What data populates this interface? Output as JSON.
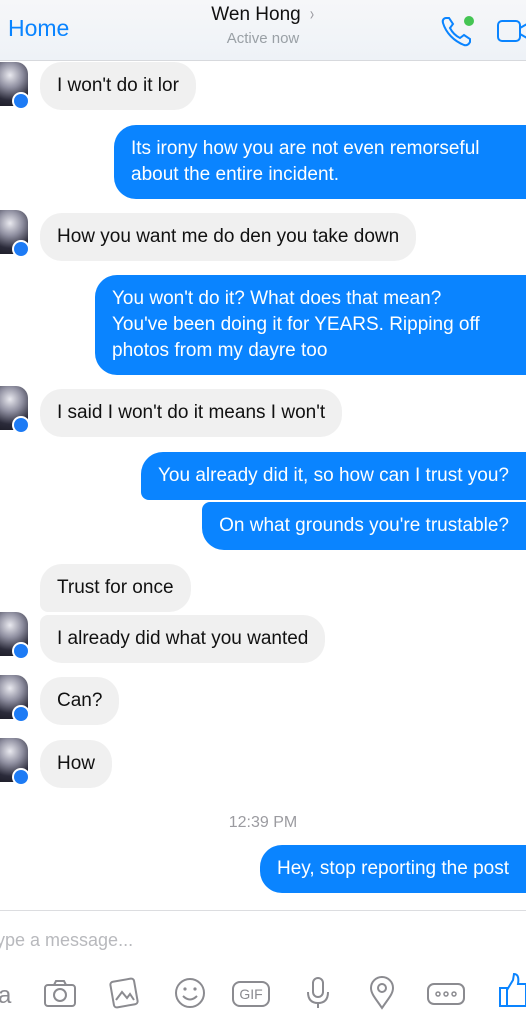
{
  "header": {
    "back_label": "Home",
    "contact_name": "Wen Hong",
    "chevron": "›",
    "status": "Active now",
    "icons": [
      "phone-icon",
      "video-icon",
      "online-dot-icon"
    ]
  },
  "messages": [
    {
      "from": "them",
      "text": "I won't do it lor"
    },
    {
      "from": "me",
      "lines": [
        "Its irony how you are not even remorseful",
        "about the entire incident."
      ]
    },
    {
      "from": "them",
      "text": "How you want me do den you take down"
    },
    {
      "from": "me",
      "lines": [
        "You won't do it? What does that mean?",
        "You've been doing it for YEARS. Ripping off",
        "photos from my dayre too"
      ]
    },
    {
      "from": "them",
      "text": "I said I won't do it means I won't"
    },
    {
      "from": "me",
      "text": "You already did it, so how can I trust you?"
    },
    {
      "from": "me",
      "text": "On what grounds you're trustable?"
    },
    {
      "from": "them",
      "text": "Trust for once"
    },
    {
      "from": "them",
      "text": "I already did what you wanted"
    },
    {
      "from": "them",
      "text": "Can?"
    },
    {
      "from": "them",
      "text": "How"
    },
    {
      "from": "me",
      "text": "Hey, stop reporting the post"
    }
  ],
  "timestamp": "12:39 PM",
  "composer": {
    "placeholder": "ype a message...",
    "left_fragment": "a",
    "gif_label": "GIF",
    "toolbar_icons": [
      "camera-icon",
      "gallery-icon",
      "emoji-icon",
      "gif-icon",
      "microphone-icon",
      "location-icon",
      "more-icon",
      "like-icon"
    ]
  },
  "colors": {
    "accent": "#0a84ff",
    "incoming_bubble": "#f0f0f0",
    "online": "#44c553"
  }
}
